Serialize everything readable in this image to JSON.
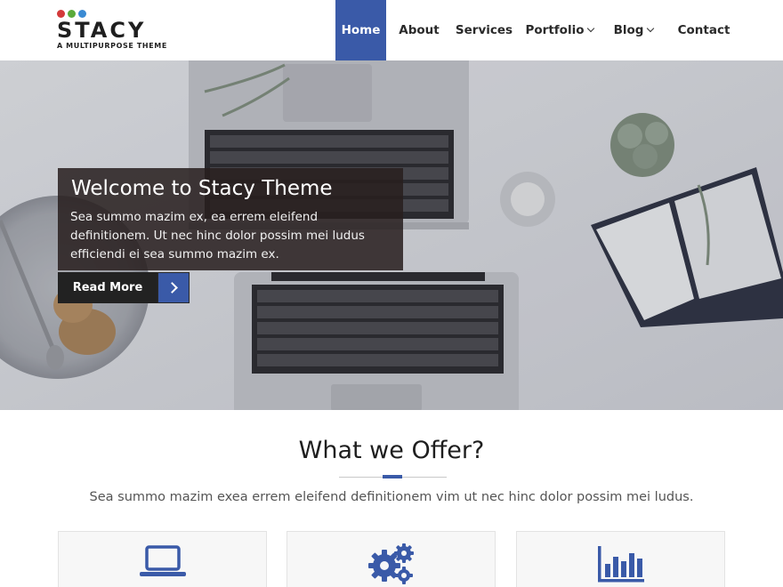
{
  "header": {
    "logo": {
      "name": "STACY",
      "tagline": "A MULTIPURPOSE THEME",
      "dot_colors": [
        "#d33a3a",
        "#5aaa3a",
        "#3a8ad3"
      ]
    },
    "nav": [
      {
        "label": "Home",
        "active": true
      },
      {
        "label": "About"
      },
      {
        "label": "Services"
      },
      {
        "label": "Portfolio",
        "dropdown": true
      },
      {
        "label": "Blog",
        "dropdown": true
      },
      {
        "label": "Contact"
      }
    ]
  },
  "hero": {
    "title": "Welcome to Stacy Theme",
    "text": "Sea summo mazim ex, ea errem eleifend definitionem. Ut nec hinc dolor possim mei ludus efficiendi ei sea summo mazim ex.",
    "button_label": "Read More",
    "button_icon": "chevron-right-icon"
  },
  "offer": {
    "title": "What we Offer?",
    "subtitle": "Sea summo mazim exea errem eleifend definitionem vim ut nec hinc dolor possim mei ludus.",
    "cards": [
      {
        "icon": "laptop-icon"
      },
      {
        "icon": "gears-icon"
      },
      {
        "icon": "bar-chart-icon"
      }
    ]
  },
  "colors": {
    "accent": "#3a5aa8",
    "dark": "#222222"
  }
}
